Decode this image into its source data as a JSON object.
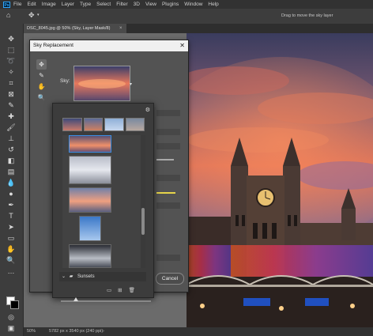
{
  "app": {
    "logo": "Ps"
  },
  "menu": [
    "File",
    "Edit",
    "Image",
    "Layer",
    "Type",
    "Select",
    "Filter",
    "3D",
    "View",
    "Plugins",
    "Window",
    "Help"
  ],
  "options_bar": {
    "hint": "Drag to move the sky layer"
  },
  "document": {
    "tab_title": "DSC_8045.jpg @ 50% (Sky, Layer Mask/8)",
    "close": "×"
  },
  "status": {
    "zoom": "50%",
    "dimensions": "5782 px x 3540 px (240 ppi)"
  },
  "toolbar": [
    "move-icon",
    "marquee-icon",
    "lasso-icon",
    "magic-wand-icon",
    "crop-icon",
    "frame-icon",
    "eyedropper-icon",
    "healing-icon",
    "brush-icon",
    "stamp-icon",
    "history-brush-icon",
    "eraser-icon",
    "gradient-icon",
    "blur-icon",
    "dodge-icon",
    "pen-icon",
    "type-icon",
    "path-select-icon",
    "shape-icon",
    "hand-icon",
    "zoom-icon",
    "more-icon"
  ],
  "dialog": {
    "title": "Sky Replacement",
    "close": "✕",
    "sky_label": "Sky:",
    "cancel": "Cancel",
    "tools": [
      "move-sky-icon",
      "sky-brush-icon",
      "hand-icon",
      "zoom-icon"
    ]
  },
  "picker": {
    "folder": "Sunsets",
    "gear": "⚙",
    "footer": [
      "▭",
      "⊞",
      "🗑"
    ]
  },
  "colors": {
    "accent": "#31a8ff",
    "dialog_bg": "#535353",
    "popup_bg": "#3c3c3c"
  }
}
